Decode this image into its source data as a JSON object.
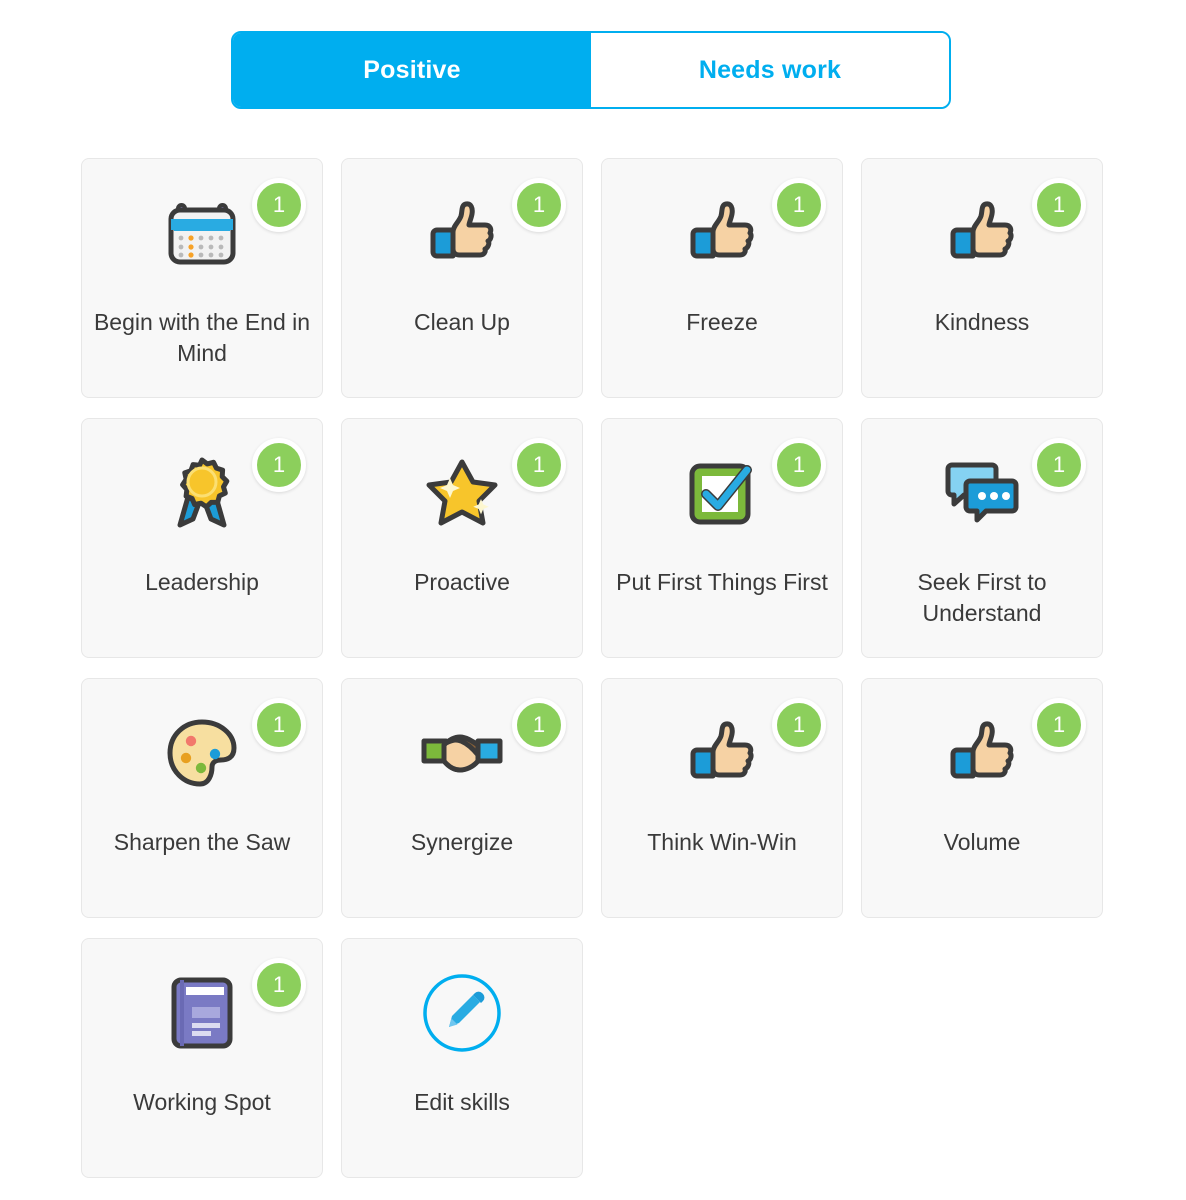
{
  "tabs": [
    {
      "label": "Positive",
      "active": true
    },
    {
      "label": "Needs work",
      "active": false
    }
  ],
  "colors": {
    "accent_blue": "#00aeef",
    "badge_green": "#8ccf5c",
    "card_bg": "#f8f8f8",
    "card_border": "#e7e7e7",
    "label_text": "#3a3a3a",
    "page_bg": "#ffffff"
  },
  "skills": [
    {
      "label": "Begin with the End in Mind",
      "count": "1",
      "icon": "calendar-icon"
    },
    {
      "label": "Clean Up",
      "count": "1",
      "icon": "thumbs-up-icon"
    },
    {
      "label": "Freeze",
      "count": "1",
      "icon": "thumbs-up-icon"
    },
    {
      "label": "Kindness",
      "count": "1",
      "icon": "thumbs-up-icon"
    },
    {
      "label": "Leadership",
      "count": "1",
      "icon": "award-ribbon-icon"
    },
    {
      "label": "Proactive",
      "count": "1",
      "icon": "star-icon"
    },
    {
      "label": "Put First Things First",
      "count": "1",
      "icon": "checkbox-check-icon"
    },
    {
      "label": "Seek First to Understand",
      "count": "1",
      "icon": "speech-bubbles-icon"
    },
    {
      "label": "Sharpen the Saw",
      "count": "1",
      "icon": "paint-palette-icon"
    },
    {
      "label": "Synergize",
      "count": "1",
      "icon": "handshake-icon"
    },
    {
      "label": "Think Win-Win",
      "count": "1",
      "icon": "thumbs-up-icon"
    },
    {
      "label": "Volume",
      "count": "1",
      "icon": "thumbs-up-icon"
    },
    {
      "label": "Working Spot",
      "count": "1",
      "icon": "notebook-icon"
    },
    {
      "label": "Edit skills",
      "count": null,
      "icon": "edit-pencil-circle-icon"
    }
  ]
}
